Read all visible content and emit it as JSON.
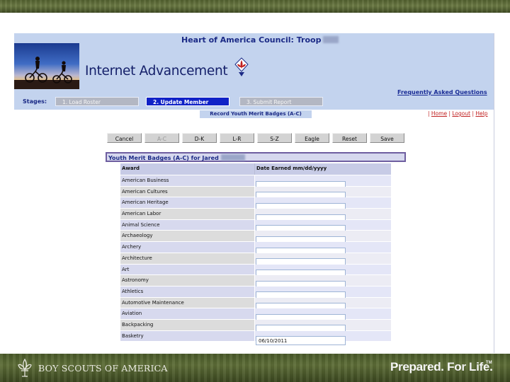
{
  "app": {
    "council_title": "Heart of America Council: Troop",
    "app_title": "Internet Advancement",
    "faq_link": "Frequently Asked Questions"
  },
  "stages": {
    "label": "Stages:",
    "items": [
      "1. Load Roster",
      "2. Update Member",
      "3. Submit Report"
    ],
    "active_index": 1
  },
  "subtitle": "Record Youth Merit Badges (A-C)",
  "nav": {
    "separator": "|",
    "home": "Home",
    "logout": "Logout",
    "help": "Help"
  },
  "buttons": [
    "Cancel",
    "A-C",
    "D-K",
    "L-R",
    "S-Z",
    "Eagle",
    "Reset",
    "Save"
  ],
  "section_title": "Youth Merit Badges (A-C) for Jared",
  "table": {
    "columns": [
      "Award",
      "Date Earned mm/dd/yyyy"
    ],
    "rows": [
      {
        "award": "American Business",
        "date": ""
      },
      {
        "award": "American Cultures",
        "date": ""
      },
      {
        "award": "American Heritage",
        "date": ""
      },
      {
        "award": "American Labor",
        "date": ""
      },
      {
        "award": "Animal Science",
        "date": ""
      },
      {
        "award": "Archaeology",
        "date": ""
      },
      {
        "award": "Archery",
        "date": ""
      },
      {
        "award": "Architecture",
        "date": ""
      },
      {
        "award": "Art",
        "date": ""
      },
      {
        "award": "Astronomy",
        "date": ""
      },
      {
        "award": "Athletics",
        "date": ""
      },
      {
        "award": "Automotive Maintenance",
        "date": ""
      },
      {
        "award": "Aviation",
        "date": ""
      },
      {
        "award": "Backpacking",
        "date": ""
      },
      {
        "award": "Basketry",
        "date": "06/10/2011"
      }
    ]
  },
  "footer": {
    "org_name": "BOY SCOUTS OF AMERICA",
    "tagline": "Prepared. For Life.",
    "trademark": "TM"
  },
  "colors": {
    "header_bg": "#c3d3ee",
    "title_blue": "#15206a",
    "active_stage": "#1022c7",
    "link_red": "#c02020",
    "band_green": "#52602f"
  },
  "icons": {
    "fleur": "fleur-de-lis-icon",
    "photo": "cyclists-sunset-photo"
  }
}
